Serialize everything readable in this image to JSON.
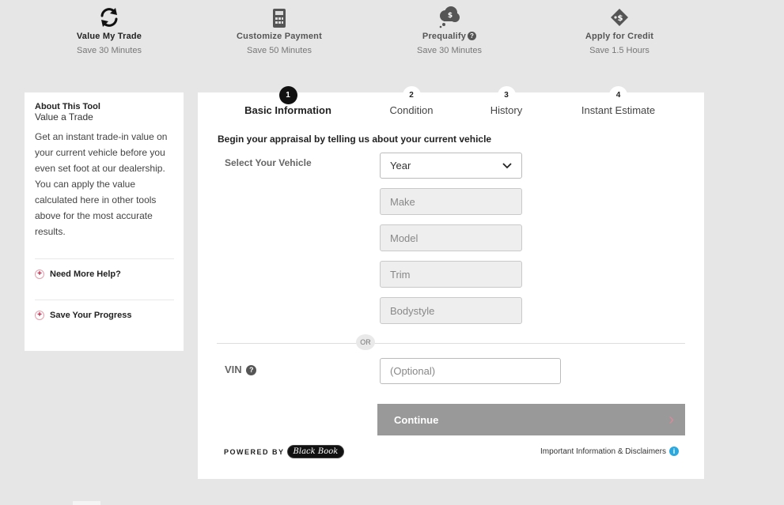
{
  "tool_tabs": [
    {
      "name": "Value My Trade",
      "sub": "Save 30 Minutes",
      "icon": "sync-icon",
      "active": true
    },
    {
      "name": "Customize Payment",
      "sub": "Save 50 Minutes",
      "icon": "calculator-icon",
      "active": false
    },
    {
      "name": "Prequalify",
      "sub": "Save 30 Minutes",
      "icon": "money-cloud-icon",
      "active": false,
      "help": "?"
    },
    {
      "name": "Apply for Credit",
      "sub": "Save 1.5 Hours",
      "icon": "credit-tag-icon",
      "active": false
    }
  ],
  "sidebar": {
    "heading": "About This Tool",
    "subheading": "Value a Trade",
    "description": "Get an instant trade-in value on your current vehicle before you even set foot at our dealership. You can apply the value calculated here in other tools above for the most accurate results.",
    "links": [
      "Need More Help?",
      "Save Your Progress"
    ]
  },
  "steps": [
    {
      "num": "1",
      "label": "Basic Information",
      "active": true
    },
    {
      "num": "2",
      "label": "Condition",
      "active": false
    },
    {
      "num": "3",
      "label": "History",
      "active": false
    },
    {
      "num": "4",
      "label": "Instant Estimate",
      "active": false
    }
  ],
  "form": {
    "intro": "Begin your appraisal by telling us about your current vehicle",
    "select_label": "Select Your Vehicle",
    "year": "Year",
    "make": "Make",
    "model": "Model",
    "trim": "Trim",
    "bodystyle": "Bodystyle",
    "or": "OR",
    "vin_label": "VIN",
    "vin_help": "?",
    "vin_placeholder": "(Optional)",
    "continue": "Continue",
    "continue_chevron": "›"
  },
  "footer": {
    "powered_by": "POWERED BY",
    "logo": "Black Book",
    "disclaimer": "Important Information & Disclaimers",
    "info": "i"
  },
  "colors": {
    "accent": "#c8193c",
    "info": "#2aa8e0",
    "button_disabled": "#999999"
  }
}
